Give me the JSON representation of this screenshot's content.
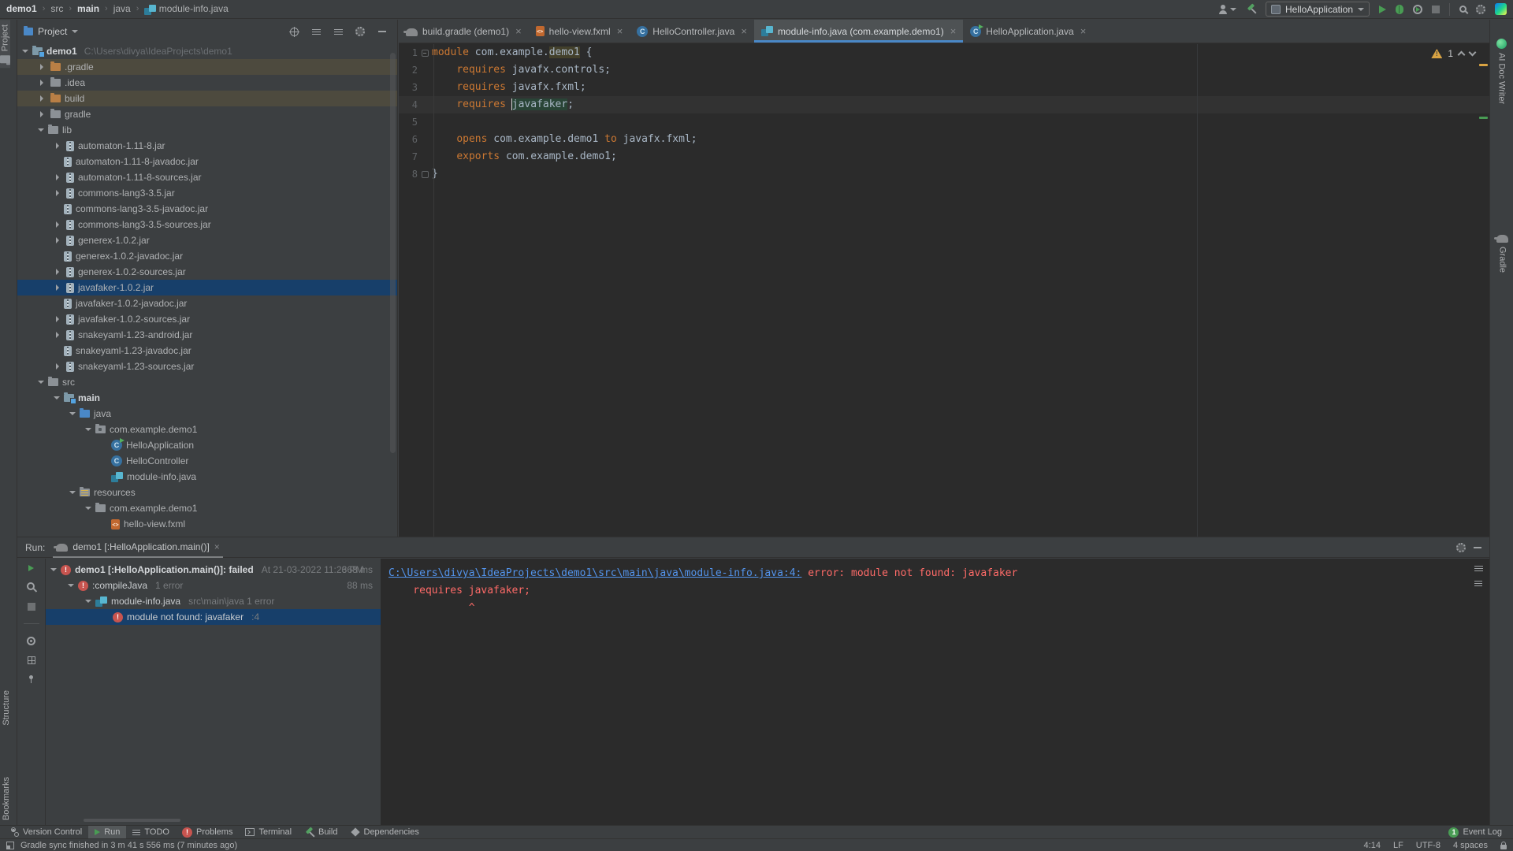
{
  "toolbar": {
    "breadcrumbs": [
      {
        "label": "demo1",
        "bold": true
      },
      {
        "label": "src",
        "bold": false
      },
      {
        "label": "main",
        "bold": true
      },
      {
        "label": "java",
        "bold": false
      },
      {
        "label": "module-info.java",
        "bold": false,
        "icon": "module"
      }
    ],
    "run_config": "HelloApplication"
  },
  "left_stripe": {
    "top": [
      {
        "label": "Project",
        "icon": "folder",
        "active": true
      }
    ],
    "bottom": [
      {
        "label": "Structure"
      },
      {
        "label": "Bookmarks"
      }
    ]
  },
  "right_stripe": [
    {
      "label": "AI Doc Writer",
      "icon": "ai"
    },
    {
      "label": "Gradle",
      "icon": "gradle"
    }
  ],
  "project_panel": {
    "title": "Project",
    "tree": [
      {
        "label": "demo1",
        "suffix": "C:\\Users\\divya\\IdeaProjects\\demo1",
        "depth": 0,
        "icon": "folder-proj",
        "chev": "exp",
        "bold": true
      },
      {
        "label": ".gradle",
        "depth": 1,
        "icon": "folder-exc",
        "chev": "col",
        "olive": true
      },
      {
        "label": ".idea",
        "depth": 1,
        "icon": "folder",
        "chev": "col"
      },
      {
        "label": "build",
        "depth": 1,
        "icon": "folder-exc",
        "chev": "col",
        "olive": true
      },
      {
        "label": "gradle",
        "depth": 1,
        "icon": "folder",
        "chev": "col"
      },
      {
        "label": "lib",
        "depth": 1,
        "icon": "folder",
        "chev": "exp"
      },
      {
        "label": "automaton-1.11-8.jar",
        "depth": 2,
        "icon": "jar",
        "chev": "col"
      },
      {
        "label": "automaton-1.11-8-javadoc.jar",
        "depth": 2,
        "icon": "jar",
        "chev": "none"
      },
      {
        "label": "automaton-1.11-8-sources.jar",
        "depth": 2,
        "icon": "jar",
        "chev": "col"
      },
      {
        "label": "commons-lang3-3.5.jar",
        "depth": 2,
        "icon": "jar",
        "chev": "col"
      },
      {
        "label": "commons-lang3-3.5-javadoc.jar",
        "depth": 2,
        "icon": "jar",
        "chev": "none"
      },
      {
        "label": "commons-lang3-3.5-sources.jar",
        "depth": 2,
        "icon": "jar",
        "chev": "col"
      },
      {
        "label": "generex-1.0.2.jar",
        "depth": 2,
        "icon": "jar",
        "chev": "col"
      },
      {
        "label": "generex-1.0.2-javadoc.jar",
        "depth": 2,
        "icon": "jar",
        "chev": "none"
      },
      {
        "label": "generex-1.0.2-sources.jar",
        "depth": 2,
        "icon": "jar",
        "chev": "col"
      },
      {
        "label": "javafaker-1.0.2.jar",
        "depth": 2,
        "icon": "jar",
        "chev": "col",
        "sel": true
      },
      {
        "label": "javafaker-1.0.2-javadoc.jar",
        "depth": 2,
        "icon": "jar",
        "chev": "none"
      },
      {
        "label": "javafaker-1.0.2-sources.jar",
        "depth": 2,
        "icon": "jar",
        "chev": "col"
      },
      {
        "label": "snakeyaml-1.23-android.jar",
        "depth": 2,
        "icon": "jar",
        "chev": "col"
      },
      {
        "label": "snakeyaml-1.23-javadoc.jar",
        "depth": 2,
        "icon": "jar",
        "chev": "none"
      },
      {
        "label": "snakeyaml-1.23-sources.jar",
        "depth": 2,
        "icon": "jar",
        "chev": "col"
      },
      {
        "label": "src",
        "depth": 1,
        "icon": "folder",
        "chev": "exp"
      },
      {
        "label": "main",
        "depth": 2,
        "icon": "folder-main",
        "chev": "exp",
        "bold": true
      },
      {
        "label": "java",
        "depth": 3,
        "icon": "folder-src",
        "chev": "exp"
      },
      {
        "label": "com.example.demo1",
        "depth": 4,
        "icon": "folder-pkg",
        "chev": "exp"
      },
      {
        "label": "HelloApplication",
        "depth": 5,
        "icon": "class-run",
        "chev": "none"
      },
      {
        "label": "HelloController",
        "depth": 5,
        "icon": "class",
        "chev": "none"
      },
      {
        "label": "module-info.java",
        "depth": 5,
        "icon": "module",
        "chev": "none"
      },
      {
        "label": "resources",
        "depth": 3,
        "icon": "folder-res",
        "chev": "exp"
      },
      {
        "label": "com.example.demo1",
        "depth": 4,
        "icon": "folder",
        "chev": "exp"
      },
      {
        "label": "hello-view.fxml",
        "depth": 5,
        "icon": "fxml",
        "chev": "none"
      }
    ]
  },
  "tabs": [
    {
      "label": "build.gradle (demo1)",
      "icon": "gradle",
      "active": false
    },
    {
      "label": "hello-view.fxml",
      "icon": "fxml",
      "active": false
    },
    {
      "label": "HelloController.java",
      "icon": "class",
      "active": false
    },
    {
      "label": "module-info.java (com.example.demo1)",
      "icon": "module",
      "active": true
    },
    {
      "label": "HelloApplication.java",
      "icon": "class-run",
      "active": false
    }
  ],
  "editor": {
    "warning_count": "1",
    "lines": [
      {
        "n": "1",
        "fold": "-",
        "tokens": [
          {
            "t": "module ",
            "c": "kw"
          },
          {
            "t": "com.example.",
            "c": "pl"
          },
          {
            "t": "demo1",
            "c": "pl hl-olive"
          },
          {
            "t": " {",
            "c": "pl"
          }
        ]
      },
      {
        "n": "2",
        "tokens": [
          {
            "t": "    ",
            "c": "pl"
          },
          {
            "t": "requires ",
            "c": "kw"
          },
          {
            "t": "javafx.controls;",
            "c": "pl"
          }
        ]
      },
      {
        "n": "3",
        "tokens": [
          {
            "t": "    ",
            "c": "pl"
          },
          {
            "t": "requires ",
            "c": "kw"
          },
          {
            "t": "javafx.fxml;",
            "c": "pl"
          }
        ]
      },
      {
        "n": "4",
        "current": true,
        "tokens": [
          {
            "t": "    ",
            "c": "pl"
          },
          {
            "t": "requires ",
            "c": "kw"
          },
          {
            "caret": true
          },
          {
            "t": "javafaker",
            "c": "pl hl-green"
          },
          {
            "t": ";",
            "c": "pl"
          }
        ]
      },
      {
        "n": "5",
        "tokens": []
      },
      {
        "n": "6",
        "tokens": [
          {
            "t": "    ",
            "c": "pl"
          },
          {
            "t": "opens ",
            "c": "kw"
          },
          {
            "t": "com.example.demo1 ",
            "c": "pl"
          },
          {
            "t": "to ",
            "c": "kw"
          },
          {
            "t": "javafx.fxml;",
            "c": "pl"
          }
        ]
      },
      {
        "n": "7",
        "tokens": [
          {
            "t": "    ",
            "c": "pl"
          },
          {
            "t": "exports ",
            "c": "kw"
          },
          {
            "t": "com.example.demo1;",
            "c": "pl"
          }
        ]
      },
      {
        "n": "8",
        "fold": "+",
        "tokens": [
          {
            "t": "}",
            "c": "pl"
          }
        ]
      }
    ]
  },
  "run_panel": {
    "label": "Run:",
    "tab": "demo1 [:HelloApplication.main()]",
    "tree": [
      {
        "chev": "exp",
        "icon": "error",
        "text": "demo1 [:HelloApplication.main()]: failed",
        "meta": "At 21-03-2022 11:26 PM",
        "time": "368 ms",
        "bold": true
      },
      {
        "chev": "exp",
        "icon": "error",
        "text": ":compileJava",
        "meta": "1 error",
        "time": "88 ms",
        "bold": false
      },
      {
        "chev": "exp",
        "icon": "module",
        "text": "module-info.java",
        "meta": "src\\main\\java 1 error",
        "time": "",
        "bold": false
      },
      {
        "chev": "none",
        "icon": "error",
        "text": "module not found: javafaker",
        "meta": ":4",
        "time": "",
        "sel": true,
        "bold": false
      }
    ],
    "console": [
      {
        "link": "C:\\Users\\divya\\IdeaProjects\\demo1\\src\\main\\java\\module-info.java:4:",
        "error": " error: module not found: javafaker"
      },
      {
        "error": "    requires javafaker;"
      },
      {
        "error": "             ^"
      }
    ]
  },
  "bottom_bar": {
    "items": [
      {
        "label": "Version Control",
        "icon": "vcs",
        "active": false
      },
      {
        "label": "Run",
        "icon": "play",
        "active": true
      },
      {
        "label": "TODO",
        "icon": "list",
        "active": false
      },
      {
        "label": "Problems",
        "icon": "error",
        "active": false
      },
      {
        "label": "Terminal",
        "icon": "terminal",
        "active": false
      },
      {
        "label": "Build",
        "icon": "hammer",
        "active": false
      },
      {
        "label": "Dependencies",
        "icon": "deps",
        "active": false
      }
    ],
    "event_log": {
      "label": "Event Log",
      "badge": "1"
    }
  },
  "status_bar": {
    "left": "Gradle sync finished in 3 m 41 s 556 ms (7 minutes ago)",
    "right": [
      "4:14",
      "LF",
      "UTF-8",
      "4 spaces"
    ]
  }
}
